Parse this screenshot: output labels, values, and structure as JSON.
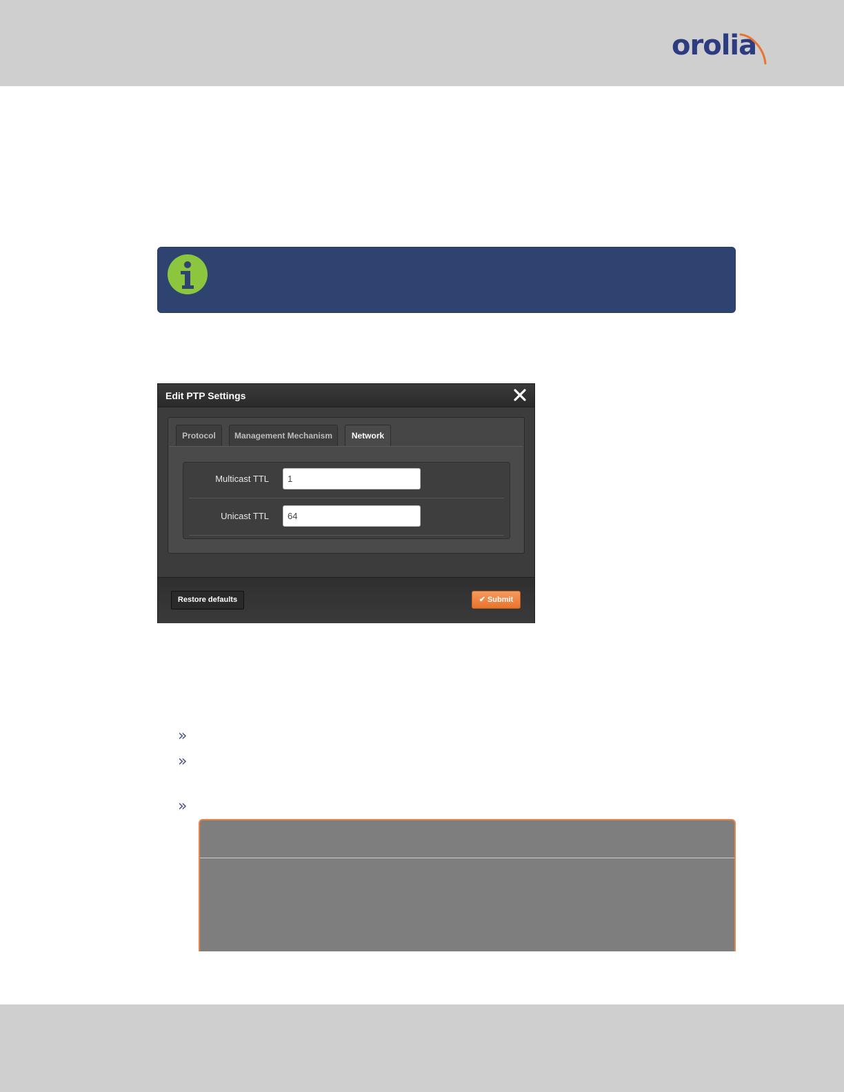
{
  "brand": {
    "logo_text": "orolia",
    "accent_color": "#e8742d",
    "primary_color": "#2d3b80"
  },
  "note": {
    "icon": "info-icon",
    "color": "#2e4370",
    "icon_color": "#8cc63f"
  },
  "dialog": {
    "title": "Edit PTP Settings",
    "close_icon": "close-icon",
    "tabs": [
      {
        "label": "Protocol",
        "active": false
      },
      {
        "label": "Management Mechanism",
        "active": false
      },
      {
        "label": "Network",
        "active": true
      }
    ],
    "fields": [
      {
        "label": "Multicast TTL",
        "value": "1"
      },
      {
        "label": "Unicast TTL",
        "value": "64"
      }
    ],
    "footer": {
      "restore_label": "Restore defaults",
      "submit_label": "Submit",
      "submit_icon": "check-icon"
    }
  },
  "bullets": {
    "icon": "double-chevron-right-icon",
    "glyph": "»",
    "count": 3
  },
  "warning": {
    "border_color": "#e6854a",
    "background": "#7f7e7e"
  }
}
